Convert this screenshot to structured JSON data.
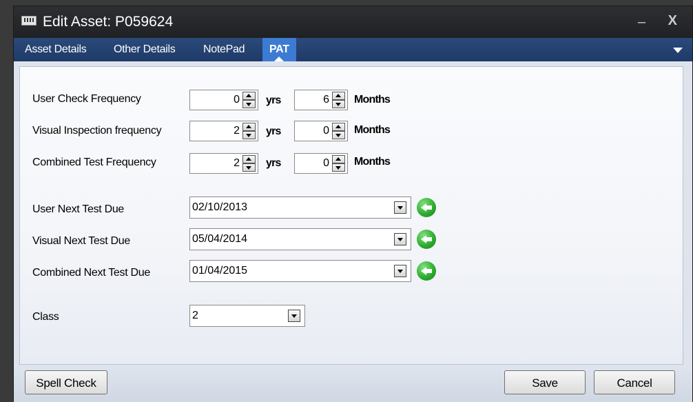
{
  "window": {
    "title": "Edit Asset: P059624",
    "minimize_label": "–",
    "close_label": "X"
  },
  "tabs": [
    {
      "label": "Asset Details"
    },
    {
      "label": "Other Details"
    },
    {
      "label": "NotePad"
    },
    {
      "label": "PAT",
      "active": true
    }
  ],
  "frequencies": [
    {
      "label": "User Check Frequency",
      "years": "0",
      "months": "6"
    },
    {
      "label": "Visual Inspection frequency",
      "years": "2",
      "months": "0"
    },
    {
      "label": "Combined Test Frequency",
      "years": "2",
      "months": "0"
    }
  ],
  "units": {
    "years": "yrs",
    "months": "Months"
  },
  "due_dates": [
    {
      "label": "User Next Test Due",
      "value": "02/10/2013"
    },
    {
      "label": "Visual Next Test Due",
      "value": "05/04/2014"
    },
    {
      "label": "Combined Next Test Due",
      "value": "01/04/2015"
    }
  ],
  "class_field": {
    "label": "Class",
    "value": "2"
  },
  "footer": {
    "spell_check": "Spell Check",
    "save": "Save",
    "cancel": "Cancel"
  },
  "colors": {
    "tab_bar": "#1e3a68",
    "active_tab": "#3d7bd3",
    "title_bar": "#1f2124"
  }
}
